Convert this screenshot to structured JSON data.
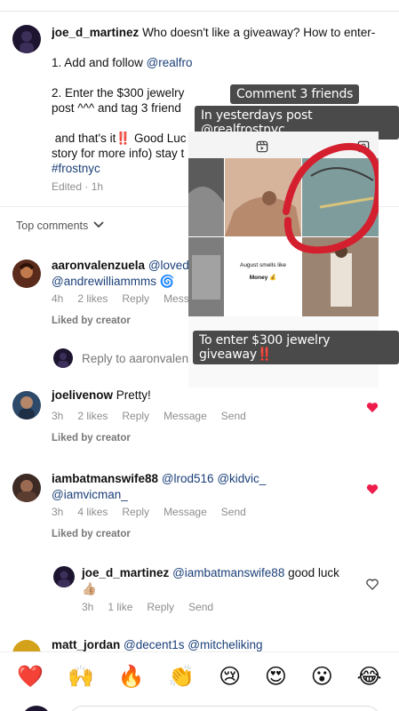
{
  "post": {
    "author": "joe_d_martinez",
    "line1": "Who doesn't like a giveaway? How to enter-",
    "step1_text": "1. Add and follow ",
    "step1_mention": "@realfro",
    "step2_line1": "2. Enter the $300 jewelry",
    "step2_line2": "post ^^^ and tag 3 friend",
    "end_prefix": "and that's it",
    "end_emoji": "‼️",
    "end_suffix": " Good Luc",
    "end_line2": "story for more info) stay t",
    "hashtag": "#frostnyc",
    "edited": "Edited · 1h"
  },
  "top_comments_label": "Top comments",
  "comments": [
    {
      "user": "aaronvalenzuela",
      "mention1": "@lovede",
      "mention2": "@andrewilliammms",
      "emoji": "🌀",
      "time": "4h",
      "likes": "2 likes",
      "reply": "Reply",
      "message": "Mess",
      "liked_by": "Liked by creator",
      "reply_to": "Reply to aaronvalen"
    },
    {
      "user": "joelivenow",
      "text": "Pretty!",
      "time": "3h",
      "likes": "2 likes",
      "reply": "Reply",
      "message": "Message",
      "send": "Send",
      "liked_by": "Liked by creator"
    },
    {
      "user": "iambatmanswife88",
      "mention1": "@lrod516",
      "mention2": "@kidvic_",
      "mention3": "@iamvicman_",
      "time": "3h",
      "likes": "4 likes",
      "reply": "Reply",
      "message": "Message",
      "send": "Send",
      "liked_by": "Liked by creator"
    },
    {
      "user": "joe_d_martinez",
      "mention": "@iambatmanswife88",
      "text": "good luck",
      "emoji": "👍🏼",
      "time": "3h",
      "likes": "1 like",
      "reply": "Reply",
      "send": "Send"
    },
    {
      "user": "matt_jordan",
      "mention1": "@decent1s",
      "mention2": "@mitcheliking"
    }
  ],
  "story": {
    "label_top1": "Comment 3 friends",
    "label_top2_prefix": "In yesterdays post ",
    "label_top2_handle": "@realfrostnyc",
    "card_line1": "August smells like",
    "card_line2": "Money 💰",
    "label_bottom": "To enter $300 jewelry giveaway",
    "label_bottom_emoji": "‼️"
  },
  "reactions": [
    "❤️",
    "🙌",
    "🔥",
    "👏",
    "😢",
    "😍",
    "😮",
    "😂"
  ],
  "colors": {
    "heart": "#ed1c4b",
    "mention": "#1a3f78",
    "story_label_bg": "#4a4a4a",
    "red_circle": "#d41f2f"
  }
}
